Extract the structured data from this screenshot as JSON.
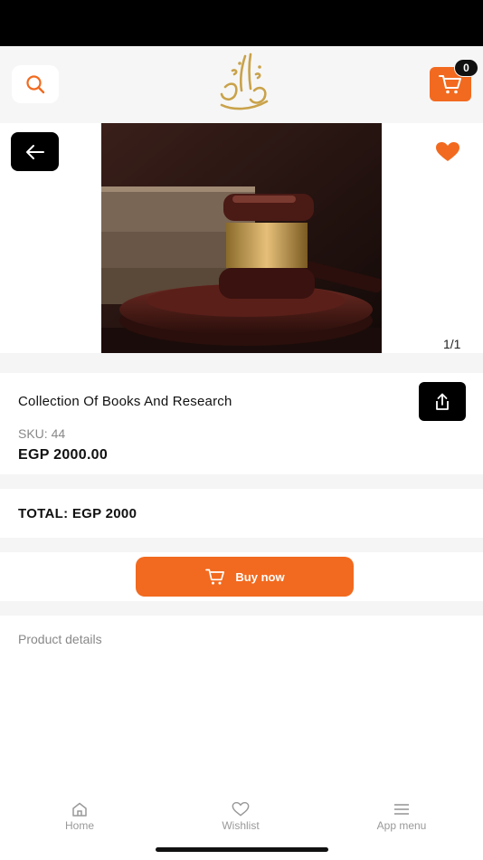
{
  "header": {
    "search_icon": "search-icon",
    "logo_icon": "calligraphy-logo",
    "cart_icon": "cart-icon",
    "cart_count": "0",
    "accent_color": "#f26a1f"
  },
  "gallery": {
    "image_counter": "1/1",
    "favorite_icon": "heart-icon",
    "favorite_color": "#f26a1f"
  },
  "product": {
    "name": "Collection Of Books And Research",
    "sku": "SKU: 44",
    "price": "EGP 2000.00"
  },
  "order": {
    "total": "TOTAL: EGP 2000",
    "buy_label": "Buy now"
  },
  "details": {
    "label": "Product details"
  },
  "nav": {
    "items": [
      {
        "label": "Home",
        "icon": "home-icon"
      },
      {
        "label": "Wishlist",
        "icon": "heart-outline-icon"
      },
      {
        "label": "App menu",
        "icon": "menu-icon"
      }
    ]
  }
}
